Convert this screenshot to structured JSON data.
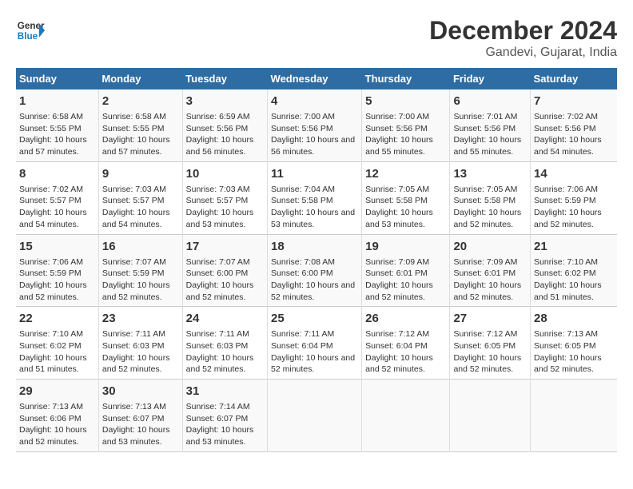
{
  "logo": {
    "text_general": "General",
    "text_blue": "Blue"
  },
  "title": "December 2024",
  "subtitle": "Gandevi, Gujarat, India",
  "days_of_week": [
    "Sunday",
    "Monday",
    "Tuesday",
    "Wednesday",
    "Thursday",
    "Friday",
    "Saturday"
  ],
  "weeks": [
    [
      {
        "day": "1",
        "sunrise": "6:58 AM",
        "sunset": "5:55 PM",
        "daylight": "10 hours and 57 minutes."
      },
      {
        "day": "2",
        "sunrise": "6:58 AM",
        "sunset": "5:55 PM",
        "daylight": "10 hours and 57 minutes."
      },
      {
        "day": "3",
        "sunrise": "6:59 AM",
        "sunset": "5:56 PM",
        "daylight": "10 hours and 56 minutes."
      },
      {
        "day": "4",
        "sunrise": "7:00 AM",
        "sunset": "5:56 PM",
        "daylight": "10 hours and 56 minutes."
      },
      {
        "day": "5",
        "sunrise": "7:00 AM",
        "sunset": "5:56 PM",
        "daylight": "10 hours and 55 minutes."
      },
      {
        "day": "6",
        "sunrise": "7:01 AM",
        "sunset": "5:56 PM",
        "daylight": "10 hours and 55 minutes."
      },
      {
        "day": "7",
        "sunrise": "7:02 AM",
        "sunset": "5:56 PM",
        "daylight": "10 hours and 54 minutes."
      }
    ],
    [
      {
        "day": "8",
        "sunrise": "7:02 AM",
        "sunset": "5:57 PM",
        "daylight": "10 hours and 54 minutes."
      },
      {
        "day": "9",
        "sunrise": "7:03 AM",
        "sunset": "5:57 PM",
        "daylight": "10 hours and 54 minutes."
      },
      {
        "day": "10",
        "sunrise": "7:03 AM",
        "sunset": "5:57 PM",
        "daylight": "10 hours and 53 minutes."
      },
      {
        "day": "11",
        "sunrise": "7:04 AM",
        "sunset": "5:58 PM",
        "daylight": "10 hours and 53 minutes."
      },
      {
        "day": "12",
        "sunrise": "7:05 AM",
        "sunset": "5:58 PM",
        "daylight": "10 hours and 53 minutes."
      },
      {
        "day": "13",
        "sunrise": "7:05 AM",
        "sunset": "5:58 PM",
        "daylight": "10 hours and 52 minutes."
      },
      {
        "day": "14",
        "sunrise": "7:06 AM",
        "sunset": "5:59 PM",
        "daylight": "10 hours and 52 minutes."
      }
    ],
    [
      {
        "day": "15",
        "sunrise": "7:06 AM",
        "sunset": "5:59 PM",
        "daylight": "10 hours and 52 minutes."
      },
      {
        "day": "16",
        "sunrise": "7:07 AM",
        "sunset": "5:59 PM",
        "daylight": "10 hours and 52 minutes."
      },
      {
        "day": "17",
        "sunrise": "7:07 AM",
        "sunset": "6:00 PM",
        "daylight": "10 hours and 52 minutes."
      },
      {
        "day": "18",
        "sunrise": "7:08 AM",
        "sunset": "6:00 PM",
        "daylight": "10 hours and 52 minutes."
      },
      {
        "day": "19",
        "sunrise": "7:09 AM",
        "sunset": "6:01 PM",
        "daylight": "10 hours and 52 minutes."
      },
      {
        "day": "20",
        "sunrise": "7:09 AM",
        "sunset": "6:01 PM",
        "daylight": "10 hours and 52 minutes."
      },
      {
        "day": "21",
        "sunrise": "7:10 AM",
        "sunset": "6:02 PM",
        "daylight": "10 hours and 51 minutes."
      }
    ],
    [
      {
        "day": "22",
        "sunrise": "7:10 AM",
        "sunset": "6:02 PM",
        "daylight": "10 hours and 51 minutes."
      },
      {
        "day": "23",
        "sunrise": "7:11 AM",
        "sunset": "6:03 PM",
        "daylight": "10 hours and 52 minutes."
      },
      {
        "day": "24",
        "sunrise": "7:11 AM",
        "sunset": "6:03 PM",
        "daylight": "10 hours and 52 minutes."
      },
      {
        "day": "25",
        "sunrise": "7:11 AM",
        "sunset": "6:04 PM",
        "daylight": "10 hours and 52 minutes."
      },
      {
        "day": "26",
        "sunrise": "7:12 AM",
        "sunset": "6:04 PM",
        "daylight": "10 hours and 52 minutes."
      },
      {
        "day": "27",
        "sunrise": "7:12 AM",
        "sunset": "6:05 PM",
        "daylight": "10 hours and 52 minutes."
      },
      {
        "day": "28",
        "sunrise": "7:13 AM",
        "sunset": "6:05 PM",
        "daylight": "10 hours and 52 minutes."
      }
    ],
    [
      {
        "day": "29",
        "sunrise": "7:13 AM",
        "sunset": "6:06 PM",
        "daylight": "10 hours and 52 minutes."
      },
      {
        "day": "30",
        "sunrise": "7:13 AM",
        "sunset": "6:07 PM",
        "daylight": "10 hours and 53 minutes."
      },
      {
        "day": "31",
        "sunrise": "7:14 AM",
        "sunset": "6:07 PM",
        "daylight": "10 hours and 53 minutes."
      },
      null,
      null,
      null,
      null
    ]
  ]
}
